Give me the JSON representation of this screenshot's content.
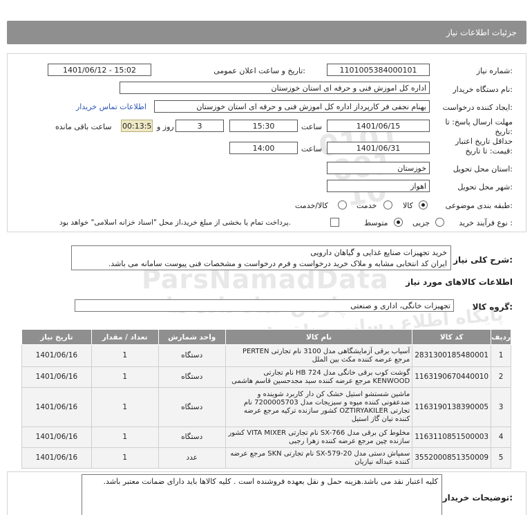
{
  "header": {
    "title": "جزئیات اطلاعات نیاز"
  },
  "form": {
    "need_number_label": "شماره نیاز:",
    "need_number": "1101005384000101",
    "announce_label": "تاریخ و ساعت اعلان عمومی:",
    "announce_value": "1401/06/12 - 15:02",
    "buyer_org_label": "نام دستگاه خریدار:",
    "buyer_org": "اداره کل اموزش فنی و حرفه ای استان خوزستان",
    "requester_label": "ایجاد کننده درخواست:",
    "requester": "بهنام  نجفی فر  کارپرداز اداره کل اموزش فنی و حرفه ای استان خوزستان",
    "contact_link": "اطلاعات تماس خریدار",
    "deadline_label": "مهلت ارسال پاسخ: تا تاریخ:",
    "deadline_date": "1401/06/15",
    "time_label": "ساعت",
    "deadline_time": "15:30",
    "days_value": "3",
    "days_label": "روز و",
    "timer_value": "00:13:51",
    "remaining_label": "ساعت باقی مانده",
    "validity_label": "حداقل تاریخ اعتبار قیمت: تا تاریخ:",
    "validity_date": "1401/06/31",
    "validity_time_label": "ساعت",
    "validity_time": "14:00",
    "province_label": "استان محل تحویل:",
    "province": "خوزستان",
    "city_label": "شهر محل تحویل:",
    "city": "اهواز",
    "category_label": "طبقه بندی موضوعی:",
    "category_options": [
      "کالا",
      "خدمت",
      "کالا/خدمت"
    ],
    "category_selected": "کالا",
    "process_label": "نوع فرآیند خرید :",
    "process_options": [
      "جزیی",
      "متوسط"
    ],
    "process_selected": "متوسط",
    "payment_note": "پرداخت تمام یا بخشی از مبلغ خرید،از محل \"اسناد خزانه اسلامی\" خواهد بود."
  },
  "summary": {
    "label": "شرح کلی نیاز:",
    "line1": "خرید تجهیزات صنایع غذایی و گیاهان دارویی",
    "line2": "ایران کد انتخابی مشابه و ملاک خرید درخواست و فرم درخواست و مشخصات فنی پیوست سامانه می باشد."
  },
  "goods": {
    "section_title": "اطلاعات کالاهای مورد نیاز",
    "group_label": "گروه کالا:",
    "group_value": "تجهیزات خانگی، اداری و صنعتی",
    "columns": [
      "ردیف",
      "کد کالا",
      "نام کالا",
      "واحد شمارش",
      "تعداد / مقدار",
      "تاریخ نیاز"
    ],
    "rows": [
      {
        "idx": "1",
        "code": "2831300185480001",
        "name": "آسیاب برقی آزمایشگاهی مدل 3100 نام تجارتی PERTEN مرجع عرضه کننده مکث بین الملل",
        "unit": "دستگاه",
        "qty": "1",
        "date": "1401/06/16"
      },
      {
        "idx": "2",
        "code": "1163190670440010",
        "name": "گوشت کوب برقی خانگی مدل HB 724 نام تجارتی KENWOOD مرجع عرضه کننده سید مجدحسین قاسم هاشمی",
        "unit": "دستگاه",
        "qty": "1",
        "date": "1401/06/16"
      },
      {
        "idx": "3",
        "code": "1163190138390005",
        "name": "ماشین شستشو استیل خشک کن دار کاربرد شوینده و ضدعفونی کننده میوه و سبزیجات مدل 7200005703 نام تجارتی OZTIRYAKILER کشور سازنده ترکیه مرجع عرضه کننده تیان گاز استیل",
        "unit": "دستگاه",
        "qty": "1",
        "date": "1401/06/16"
      },
      {
        "idx": "4",
        "code": "1163110851500003",
        "name": "مخلوط کن برقی مدل SX-766 نام تجارتی VITA MIXER کشور سازنده چین مرجع عرضه کننده زهرا رجبی",
        "unit": "دستگاه",
        "qty": "1",
        "date": "1401/06/16"
      },
      {
        "idx": "5",
        "code": "3552000851350009",
        "name": "سمپاش دستی مدل SX-579-20 نام تجارتی SKN مرجع عرضه کننده عبداله نیازیان",
        "unit": "عدد",
        "qty": "1",
        "date": "1401/06/16"
      }
    ]
  },
  "buyer_notes": {
    "label": "توضیحات خریدار:",
    "text": "کلیه اعتبار نقد می باشد.هزینه حمل و نقل بعهده فروشنده است . کلیه کالاها باید دارای ضمانت معتبر باشد."
  },
  "watermark": {
    "brand": "ParsNamadData",
    "brand_fa": "پارس نماد داده ها",
    "slogan": "پایگاه اطلاع رسانی مناقصات و مزایدات",
    "phone1": "0101",
    "phone2": "001",
    "phone3": "10",
    "phone_small": "۰۲۱-۸۸۳۴۹۶۷۰"
  },
  "colors": {
    "header_bg": "#8f8f8f",
    "link": "#2a55b5",
    "timer_bg": "#efe8c4"
  }
}
